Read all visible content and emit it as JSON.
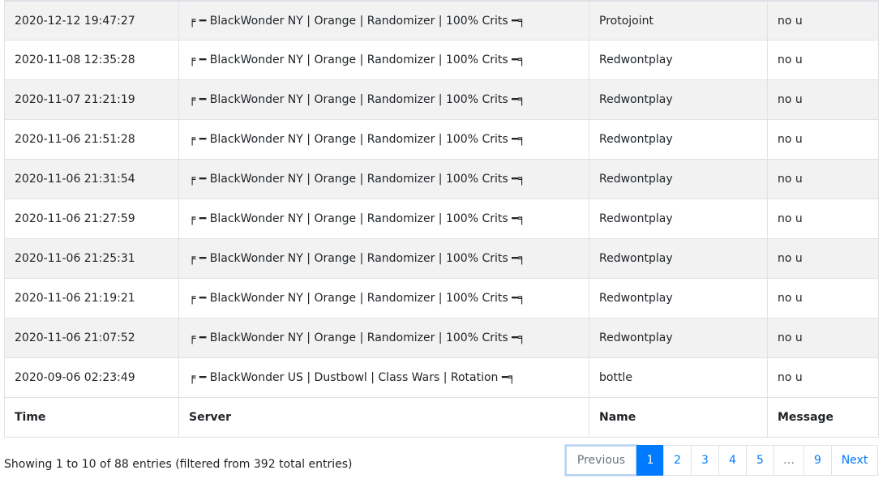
{
  "table": {
    "columns": [
      "Time",
      "Server",
      "Name",
      "Message"
    ],
    "rows": [
      [
        "2020-12-12 19:47:27",
        "╒ ━ BlackWonder NY | Orange | Randomizer | 100% Crits ━╕",
        "Protojoint",
        "no u"
      ],
      [
        "2020-11-08 12:35:28",
        "╒ ━ BlackWonder NY | Orange | Randomizer | 100% Crits ━╕",
        "Redwontplay",
        "no u"
      ],
      [
        "2020-11-07 21:21:19",
        "╒ ━ BlackWonder NY | Orange | Randomizer | 100% Crits ━╕",
        "Redwontplay",
        "no u"
      ],
      [
        "2020-11-06 21:51:28",
        "╒ ━ BlackWonder NY | Orange | Randomizer | 100% Crits ━╕",
        "Redwontplay",
        "no u"
      ],
      [
        "2020-11-06 21:31:54",
        "╒ ━ BlackWonder NY | Orange | Randomizer | 100% Crits ━╕",
        "Redwontplay",
        "no u"
      ],
      [
        "2020-11-06 21:27:59",
        "╒ ━ BlackWonder NY | Orange | Randomizer | 100% Crits ━╕",
        "Redwontplay",
        "no u"
      ],
      [
        "2020-11-06 21:25:31",
        "╒ ━ BlackWonder NY | Orange | Randomizer | 100% Crits ━╕",
        "Redwontplay",
        "no u"
      ],
      [
        "2020-11-06 21:19:21",
        "╒ ━ BlackWonder NY | Orange | Randomizer | 100% Crits ━╕",
        "Redwontplay",
        "no u"
      ],
      [
        "2020-11-06 21:07:52",
        "╒ ━ BlackWonder NY | Orange | Randomizer | 100% Crits ━╕",
        "Redwontplay",
        "no u"
      ],
      [
        "2020-09-06 02:23:49",
        "╒ ━ BlackWonder US | Dustbowl | Class Wars | Rotation ━╕",
        "bottle",
        "no u"
      ]
    ]
  },
  "info": "Showing 1 to 10 of 88 entries (filtered from 392 total entries)",
  "pagination": {
    "previous": "Previous",
    "pages": [
      "1",
      "2",
      "3",
      "4",
      "5",
      "…",
      "9"
    ],
    "active": "1",
    "next": "Next"
  },
  "colors": {
    "accent": "#007bff",
    "stripe": "#f2f2f2",
    "border": "#dee2e6"
  }
}
